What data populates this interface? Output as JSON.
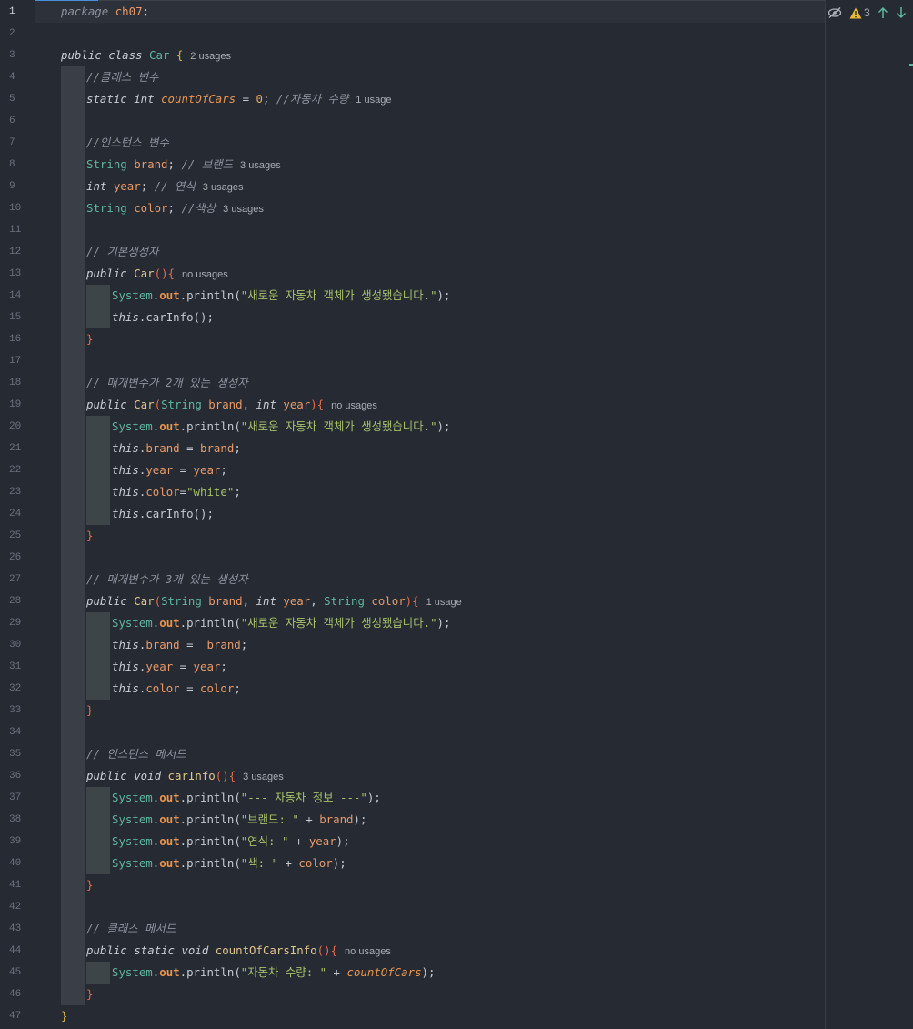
{
  "inspections": {
    "reader_mode_icon": "eye-slash-icon",
    "warning_icon": "warning-triangle-icon",
    "warning_count": "3",
    "prev_icon": "arrow-up-icon",
    "next_icon": "arrow-down-icon"
  },
  "active_line": "1",
  "lines": [
    {
      "n": "1",
      "tokens": [
        [
          "pkg",
          "package "
        ],
        [
          "pkgname",
          "ch07"
        ],
        [
          "par",
          ";"
        ]
      ]
    },
    {
      "n": "2",
      "tokens": []
    },
    {
      "n": "3",
      "tokens": [
        [
          "kw",
          "public "
        ],
        [
          "kw",
          "class "
        ],
        [
          "cls",
          "Car "
        ],
        [
          "brace",
          "{"
        ]
      ],
      "hint": "2 usages"
    },
    {
      "n": "4",
      "tokens": [
        [
          "cmt",
          "//클래스 변수"
        ]
      ]
    },
    {
      "n": "5",
      "tokens": [
        [
          "kw",
          "static "
        ],
        [
          "kw",
          "int "
        ],
        [
          "sfld",
          "countOfCars"
        ],
        [
          "par",
          " = "
        ],
        [
          "num",
          "0"
        ],
        [
          "par",
          "; "
        ],
        [
          "cmt",
          "//자동차 수량"
        ]
      ],
      "hint": "1 usage"
    },
    {
      "n": "6",
      "tokens": []
    },
    {
      "n": "7",
      "tokens": [
        [
          "cmt",
          "//인스턴스 변수"
        ]
      ]
    },
    {
      "n": "8",
      "tokens": [
        [
          "type",
          "String "
        ],
        [
          "fld",
          "brand"
        ],
        [
          "par",
          "; "
        ],
        [
          "cmt",
          "// 브랜드"
        ]
      ],
      "hint": "3 usages"
    },
    {
      "n": "9",
      "tokens": [
        [
          "kw",
          "int "
        ],
        [
          "fld",
          "year"
        ],
        [
          "par",
          "; "
        ],
        [
          "cmt",
          "// 연식"
        ]
      ],
      "hint": "3 usages"
    },
    {
      "n": "10",
      "tokens": [
        [
          "type",
          "String "
        ],
        [
          "fld",
          "color"
        ],
        [
          "par",
          "; "
        ],
        [
          "cmt",
          "//색상"
        ]
      ],
      "hint": "3 usages"
    },
    {
      "n": "11",
      "tokens": []
    },
    {
      "n": "12",
      "tokens": [
        [
          "cmt",
          "// 기본생성자"
        ]
      ]
    },
    {
      "n": "13",
      "tokens": [
        [
          "kw",
          "public "
        ],
        [
          "ctor",
          "Car"
        ],
        [
          "cbrace",
          "(){"
        ]
      ],
      "hint": "no usages"
    },
    {
      "n": "14",
      "tokens": [
        [
          "stat",
          "System"
        ],
        [
          "par",
          "."
        ],
        [
          "out",
          "out"
        ],
        [
          "par",
          "."
        ],
        [
          "meth",
          "println"
        ],
        [
          "par",
          "("
        ],
        [
          "str",
          "\"새로운 자동차 객체가 생성됐습니다.\""
        ],
        [
          "par",
          ");"
        ]
      ]
    },
    {
      "n": "15",
      "tokens": [
        [
          "this",
          "this"
        ],
        [
          "par",
          "."
        ],
        [
          "meth",
          "carInfo"
        ],
        [
          "par",
          "();"
        ]
      ]
    },
    {
      "n": "16",
      "tokens": [
        [
          "cbrace",
          "}"
        ]
      ]
    },
    {
      "n": "17",
      "tokens": []
    },
    {
      "n": "18",
      "tokens": [
        [
          "cmt",
          "// 매개변수가 2개 있는 생성자"
        ]
      ]
    },
    {
      "n": "19",
      "tokens": [
        [
          "kw",
          "public "
        ],
        [
          "ctor",
          "Car"
        ],
        [
          "cbrace",
          "("
        ],
        [
          "type",
          "String "
        ],
        [
          "fld",
          "brand"
        ],
        [
          "par",
          ", "
        ],
        [
          "kw",
          "int "
        ],
        [
          "fld",
          "year"
        ],
        [
          "cbrace",
          "){"
        ]
      ],
      "hint": "no usages"
    },
    {
      "n": "20",
      "tokens": [
        [
          "stat",
          "System"
        ],
        [
          "par",
          "."
        ],
        [
          "out",
          "out"
        ],
        [
          "par",
          "."
        ],
        [
          "meth",
          "println"
        ],
        [
          "par",
          "("
        ],
        [
          "str",
          "\"새로운 자동차 객체가 생성됐습니다.\""
        ],
        [
          "par",
          ");"
        ]
      ]
    },
    {
      "n": "21",
      "tokens": [
        [
          "this",
          "this"
        ],
        [
          "par",
          "."
        ],
        [
          "fld",
          "brand"
        ],
        [
          "par",
          " = "
        ],
        [
          "fld",
          "brand"
        ],
        [
          "par",
          ";"
        ]
      ]
    },
    {
      "n": "22",
      "tokens": [
        [
          "this",
          "this"
        ],
        [
          "par",
          "."
        ],
        [
          "fld",
          "year"
        ],
        [
          "par",
          " = "
        ],
        [
          "fld",
          "year"
        ],
        [
          "par",
          ";"
        ]
      ]
    },
    {
      "n": "23",
      "tokens": [
        [
          "this",
          "this"
        ],
        [
          "par",
          "."
        ],
        [
          "fld",
          "color"
        ],
        [
          "par",
          "="
        ],
        [
          "str",
          "\"white\""
        ],
        [
          "par",
          ";"
        ]
      ]
    },
    {
      "n": "24",
      "tokens": [
        [
          "this",
          "this"
        ],
        [
          "par",
          "."
        ],
        [
          "meth",
          "carInfo"
        ],
        [
          "par",
          "();"
        ]
      ]
    },
    {
      "n": "25",
      "tokens": [
        [
          "cbrace",
          "}"
        ]
      ]
    },
    {
      "n": "26",
      "tokens": []
    },
    {
      "n": "27",
      "tokens": [
        [
          "cmt",
          "// 매개변수가 3개 있는 생성자"
        ]
      ]
    },
    {
      "n": "28",
      "tokens": [
        [
          "kw",
          "public "
        ],
        [
          "ctor",
          "Car"
        ],
        [
          "cbrace",
          "("
        ],
        [
          "type",
          "String "
        ],
        [
          "fld",
          "brand"
        ],
        [
          "par",
          ", "
        ],
        [
          "kw",
          "int "
        ],
        [
          "fld",
          "year"
        ],
        [
          "par",
          ", "
        ],
        [
          "type",
          "String "
        ],
        [
          "fld",
          "color"
        ],
        [
          "cbrace",
          "){"
        ]
      ],
      "hint": "1 usage"
    },
    {
      "n": "29",
      "tokens": [
        [
          "stat",
          "System"
        ],
        [
          "par",
          "."
        ],
        [
          "out",
          "out"
        ],
        [
          "par",
          "."
        ],
        [
          "meth",
          "println"
        ],
        [
          "par",
          "("
        ],
        [
          "str",
          "\"새로운 자동차 객체가 생성됐습니다.\""
        ],
        [
          "par",
          ");"
        ]
      ]
    },
    {
      "n": "30",
      "tokens": [
        [
          "this",
          "this"
        ],
        [
          "par",
          "."
        ],
        [
          "fld",
          "brand"
        ],
        [
          "par",
          " =  "
        ],
        [
          "fld",
          "brand"
        ],
        [
          "par",
          ";"
        ]
      ]
    },
    {
      "n": "31",
      "tokens": [
        [
          "this",
          "this"
        ],
        [
          "par",
          "."
        ],
        [
          "fld",
          "year"
        ],
        [
          "par",
          " = "
        ],
        [
          "fld",
          "year"
        ],
        [
          "par",
          ";"
        ]
      ]
    },
    {
      "n": "32",
      "tokens": [
        [
          "this",
          "this"
        ],
        [
          "par",
          "."
        ],
        [
          "fld",
          "color"
        ],
        [
          "par",
          " = "
        ],
        [
          "fld",
          "color"
        ],
        [
          "par",
          ";"
        ]
      ]
    },
    {
      "n": "33",
      "tokens": [
        [
          "cbrace",
          "}"
        ]
      ]
    },
    {
      "n": "34",
      "tokens": []
    },
    {
      "n": "35",
      "tokens": [
        [
          "cmt",
          "// 인스턴스 메서드"
        ]
      ]
    },
    {
      "n": "36",
      "tokens": [
        [
          "kw",
          "public "
        ],
        [
          "kw",
          "void "
        ],
        [
          "ctor",
          "carInfo"
        ],
        [
          "cbrace",
          "(){"
        ]
      ],
      "hint": "3 usages"
    },
    {
      "n": "37",
      "tokens": [
        [
          "stat",
          "System"
        ],
        [
          "par",
          "."
        ],
        [
          "out",
          "out"
        ],
        [
          "par",
          "."
        ],
        [
          "meth",
          "println"
        ],
        [
          "par",
          "("
        ],
        [
          "str",
          "\"--- 자동차 정보 ---\""
        ],
        [
          "par",
          ");"
        ]
      ]
    },
    {
      "n": "38",
      "tokens": [
        [
          "stat",
          "System"
        ],
        [
          "par",
          "."
        ],
        [
          "out",
          "out"
        ],
        [
          "par",
          "."
        ],
        [
          "meth",
          "println"
        ],
        [
          "par",
          "("
        ],
        [
          "str",
          "\"브랜드: \""
        ],
        [
          "par",
          " + "
        ],
        [
          "fld",
          "brand"
        ],
        [
          "par",
          ");"
        ]
      ]
    },
    {
      "n": "39",
      "tokens": [
        [
          "stat",
          "System"
        ],
        [
          "par",
          "."
        ],
        [
          "out",
          "out"
        ],
        [
          "par",
          "."
        ],
        [
          "meth",
          "println"
        ],
        [
          "par",
          "("
        ],
        [
          "str",
          "\"연식: \""
        ],
        [
          "par",
          " + "
        ],
        [
          "fld",
          "year"
        ],
        [
          "par",
          ");"
        ]
      ]
    },
    {
      "n": "40",
      "tokens": [
        [
          "stat",
          "System"
        ],
        [
          "par",
          "."
        ],
        [
          "out",
          "out"
        ],
        [
          "par",
          "."
        ],
        [
          "meth",
          "println"
        ],
        [
          "par",
          "("
        ],
        [
          "str",
          "\"색: \""
        ],
        [
          "par",
          " + "
        ],
        [
          "fld",
          "color"
        ],
        [
          "par",
          ");"
        ]
      ]
    },
    {
      "n": "41",
      "tokens": [
        [
          "cbrace",
          "}"
        ]
      ]
    },
    {
      "n": "42",
      "tokens": []
    },
    {
      "n": "43",
      "tokens": [
        [
          "cmt",
          "// 클래스 메서드"
        ]
      ]
    },
    {
      "n": "44",
      "tokens": [
        [
          "kw",
          "public "
        ],
        [
          "kw",
          "static "
        ],
        [
          "kw",
          "void "
        ],
        [
          "ctor",
          "countOfCarsInfo"
        ],
        [
          "cbrace",
          "(){"
        ]
      ],
      "hint": "no usages"
    },
    {
      "n": "45",
      "tokens": [
        [
          "stat",
          "System"
        ],
        [
          "par",
          "."
        ],
        [
          "out",
          "out"
        ],
        [
          "par",
          "."
        ],
        [
          "meth",
          "println"
        ],
        [
          "par",
          "("
        ],
        [
          "str",
          "\"자동차 수량: \""
        ],
        [
          "par",
          " + "
        ],
        [
          "sfld",
          "countOfCars"
        ],
        [
          "par",
          ");"
        ]
      ]
    },
    {
      "n": "46",
      "tokens": [
        [
          "cbrace",
          "}"
        ]
      ]
    },
    {
      "n": "47",
      "tokens": [
        [
          "brace",
          "}"
        ]
      ]
    }
  ]
}
